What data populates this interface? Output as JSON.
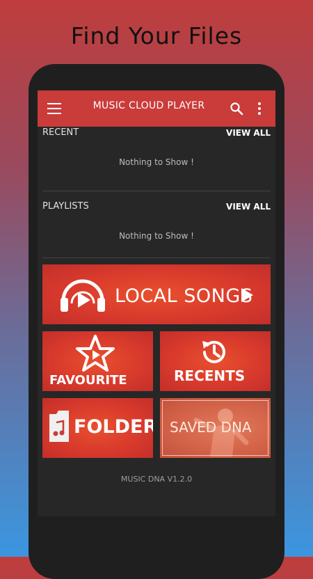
{
  "headline": "Find Your Files",
  "app": {
    "title": "MUSIC CLOUD PLAYER",
    "icons": {
      "menu": "hamburger-menu-icon",
      "search": "search-icon",
      "more": "more-vert-icon"
    }
  },
  "sections": {
    "recent": {
      "label": "RECENT",
      "view_all": "VIEW ALL",
      "empty_text": "Nothing to Show !"
    },
    "playlists": {
      "label": "PLAYLISTS",
      "view_all": "VIEW ALL",
      "empty_text": "Nothing to Show !"
    }
  },
  "tiles": {
    "local_songs": {
      "label": "LOCAL SONGS",
      "icon": "headphones-play-icon"
    },
    "favourite": {
      "label": "FAVOURITE",
      "icon": "star-play-icon"
    },
    "recents": {
      "label": "RECENTS",
      "icon": "clock-history-icon"
    },
    "folders": {
      "label": "FOLDERS",
      "icon": "music-folder-icon"
    },
    "saved_dna": {
      "label": "SAVED DNA"
    }
  },
  "version": "MUSIC DNA V1.2.0",
  "colors": {
    "accent": "#c93c3a",
    "tile_red": "#d93a2c",
    "screen_bg": "#272727"
  }
}
